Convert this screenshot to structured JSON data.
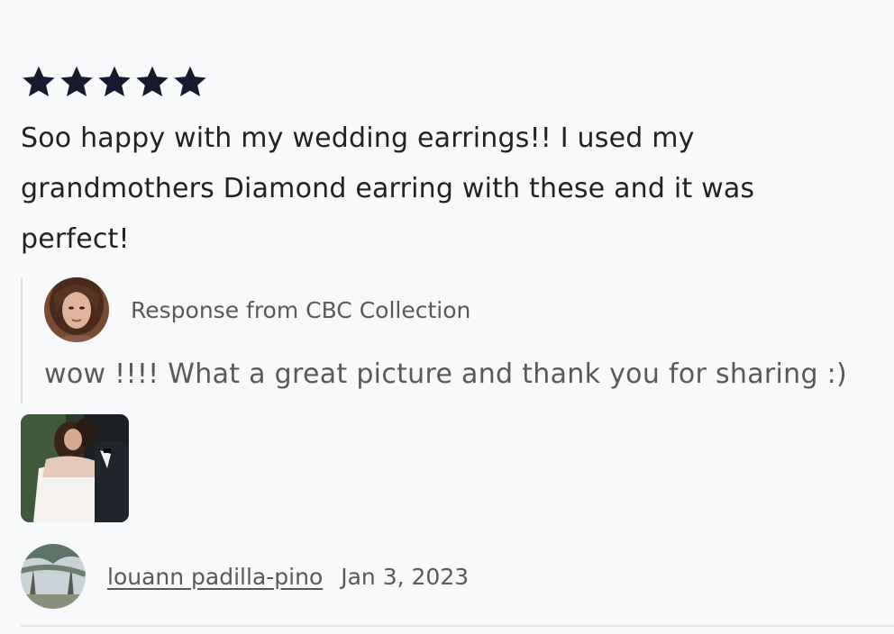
{
  "review": {
    "rating": 5,
    "rating_max": 5,
    "star_icon": "star-icon",
    "text": "Soo happy with my wedding earrings!! I used my grandmothers Diamond earring with these and it was perfect!",
    "response": {
      "from_label": "Response from CBC Collection",
      "text": "wow !!!! What a great picture and thank you for sharing :)"
    },
    "photo": {
      "alt": "Review photo"
    },
    "author": {
      "name": "louann padilla-pino",
      "date": "Jan 3, 2023"
    }
  },
  "colors": {
    "star": "#161a2e",
    "text": "#222222",
    "muted": "#595959",
    "background": "#f8f9fb"
  }
}
